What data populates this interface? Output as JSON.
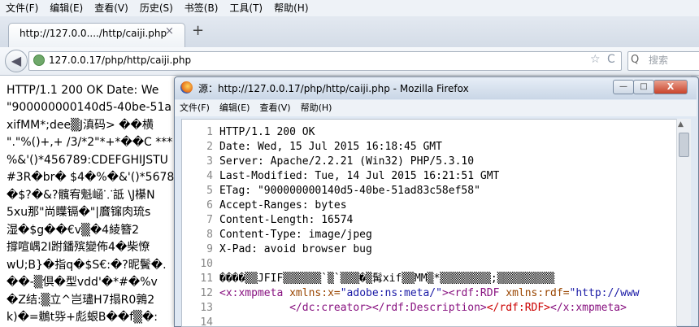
{
  "menubar": {
    "items": [
      "文件(F)",
      "编辑(E)",
      "查看(V)",
      "历史(S)",
      "书签(B)",
      "工具(T)",
      "帮助(H)"
    ]
  },
  "tab": {
    "title": "http://127.0.0..../http/caiji.php",
    "close": "×",
    "new": "+"
  },
  "nav": {
    "url": "127.0.0.17/php/http/caiji.php",
    "search_placeholder": "搜索",
    "back": "◀",
    "star": "☆",
    "reload": "C"
  },
  "background_page": {
    "lines": [
      "HTTP/1.1 200 OK Date: We",
      "\"900000000140d5-40be-51a",
      "xifMM*;dee▒J滇码> ��横",
      "\".\"%()+,+ /3/*2\"*+*��C ***",
      "%&'()*456789:CDEFGHIJSTU",
      "#3R�br� $4�%�&'()*5678",
      "�$?�&?髖宥魁崡⸪詆 \\J櫀N",
      "5xu那\"尚瞸镉�\"|黂镩肉琉s",
      "湿�$g��€v▒�4綾簪2",
      "撐喧嵎2I跗鐇殡變佈4�柴憭",
      "wU;B}�指q�$S€:�?昵鬢�.",
      "��-▒倶�型vdd'�*#�%v",
      "�Z结:▒立^岂璶H7搨R0鶉2",
      "k)�=鶒t哛+彪蛝B��f▒�:"
    ]
  },
  "viewsource": {
    "title": "源：http://127.0.0.17/php/http/caiji.php - Mozilla Firefox",
    "menu": [
      "文件(F)",
      "编辑(E)",
      "查看(V)",
      "帮助(H)"
    ],
    "win_min": "—",
    "win_max": "□",
    "win_close": "X",
    "lines": [
      {
        "n": "1",
        "t": "HTTP/1.1 200 OK"
      },
      {
        "n": "2",
        "t": "Date: Wed, 15 Jul 2015 16:18:45 GMT"
      },
      {
        "n": "3",
        "t": "Server: Apache/2.2.21 (Win32) PHP/5.3.10"
      },
      {
        "n": "4",
        "t": "Last-Modified: Tue, 14 Jul 2015 16:21:51 GMT"
      },
      {
        "n": "5",
        "t": "ETag: \"900000000140d5-40be-51ad83c58ef58\""
      },
      {
        "n": "6",
        "t": "Accept-Ranges: bytes"
      },
      {
        "n": "7",
        "t": "Content-Length: 16574"
      },
      {
        "n": "8",
        "t": "Content-Type: image/jpeg"
      },
      {
        "n": "9",
        "t": "X-Pad: avoid browser bug"
      },
      {
        "n": "10",
        "t": ""
      },
      {
        "n": "11",
        "t": "����▒▒JFIF▒▒▒▒▒▒`▒`▒▒▒�▒髯xif▒▒MM▒*▒▒▒▒▒▒▒▒;▒▒▒▒▒▒▒▒▒"
      },
      {
        "n": "12",
        "xmp1": true
      },
      {
        "n": "13",
        "xmp2": true
      },
      {
        "n": "14",
        "t": ""
      }
    ],
    "xmp1": {
      "open": "<x:xmpmeta",
      "attr": " xmlns:x=",
      "val": "\"adobe:ns:meta/\"",
      "close": ">",
      "open2": "<rdf:RDF",
      "attr2": " xmlns:rdf=",
      "val2": "\"http://www"
    },
    "xmp2": {
      "indent": "           ",
      "c1": "</dc:creator>",
      "c2": "</rdf:Description>",
      "c3": "</rdf:RDF>",
      "c4": "</x:xmpmeta>"
    }
  }
}
